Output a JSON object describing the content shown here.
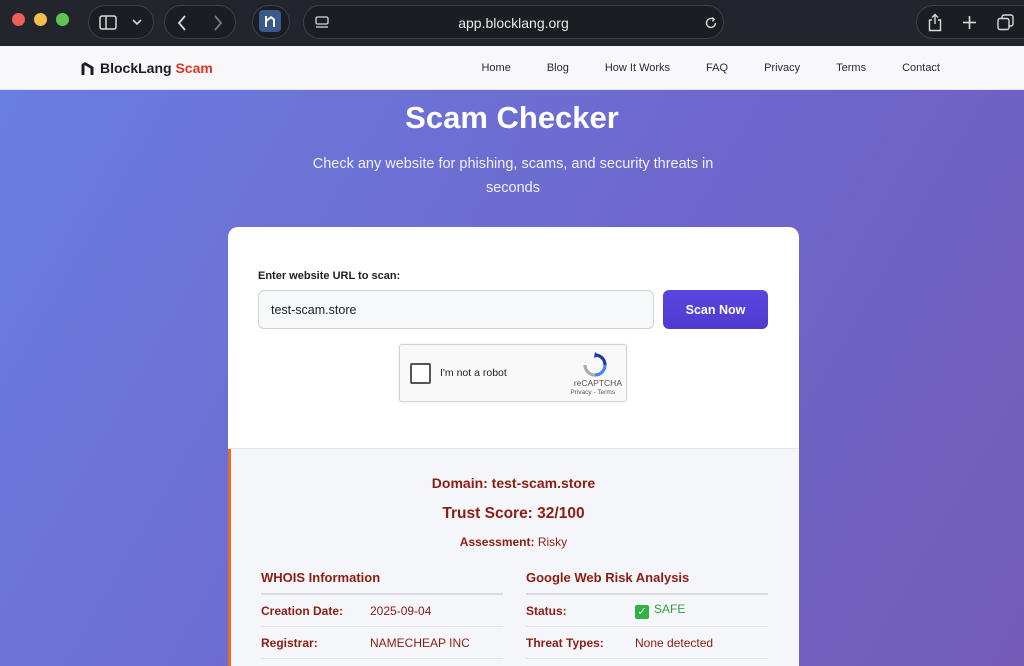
{
  "browser": {
    "url": "app.blocklang.org"
  },
  "site": {
    "brand_main": "BlockLang",
    "brand_accent": "Scam",
    "nav": [
      "Home",
      "Blog",
      "How It Works",
      "FAQ",
      "Privacy",
      "Terms",
      "Contact"
    ]
  },
  "hero": {
    "title": "Scam Checker",
    "subtitle": "Check any website for phishing, scams, and security threats in seconds"
  },
  "form": {
    "label": "Enter website URL to scan:",
    "url_value": "test-scam.store",
    "scan_button": "Scan Now"
  },
  "captcha": {
    "label": "I'm not a robot",
    "brand": "reCAPTCHA",
    "links": "Privacy - Terms"
  },
  "result": {
    "domain_line": "Domain: test-scam.store",
    "score_line": "Trust Score: 32/100",
    "assessment_key": "Assessment:",
    "assessment_value": "Risky",
    "whois": {
      "title": "WHOIS Information",
      "rows": [
        {
          "key": "Creation Date:",
          "value": "2025-09-04"
        },
        {
          "key": "Registrar:",
          "value": "NAMECHEAP INC"
        }
      ]
    },
    "webrisk": {
      "title": "Google Web Risk Analysis",
      "rows": [
        {
          "key": "Status:",
          "value": "SAFE"
        },
        {
          "key": "Threat Types:",
          "value": "None detected"
        }
      ]
    }
  },
  "colors": {
    "accent_button": "#5a46df",
    "result_text": "#8b1d12",
    "brand_accent": "#e0342a",
    "safe": "#2fb344",
    "result_bar": "#e76b2d"
  }
}
